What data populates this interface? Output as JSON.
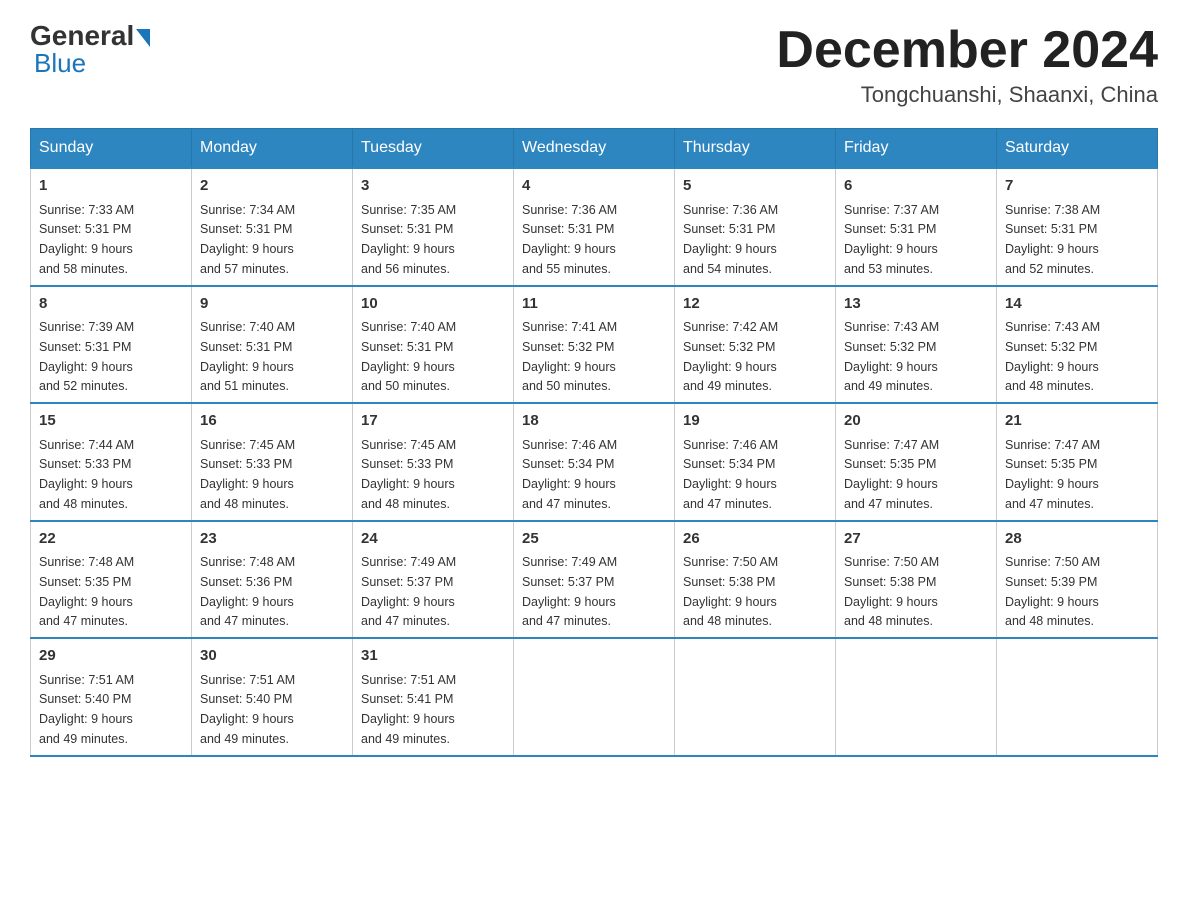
{
  "header": {
    "logo_text_general": "General",
    "logo_text_blue": "Blue",
    "month_title": "December 2024",
    "location": "Tongchuanshi, Shaanxi, China"
  },
  "days_of_week": [
    "Sunday",
    "Monday",
    "Tuesday",
    "Wednesday",
    "Thursday",
    "Friday",
    "Saturday"
  ],
  "weeks": [
    [
      {
        "day": "1",
        "sunrise": "7:33 AM",
        "sunset": "5:31 PM",
        "daylight": "9 hours and 58 minutes."
      },
      {
        "day": "2",
        "sunrise": "7:34 AM",
        "sunset": "5:31 PM",
        "daylight": "9 hours and 57 minutes."
      },
      {
        "day": "3",
        "sunrise": "7:35 AM",
        "sunset": "5:31 PM",
        "daylight": "9 hours and 56 minutes."
      },
      {
        "day": "4",
        "sunrise": "7:36 AM",
        "sunset": "5:31 PM",
        "daylight": "9 hours and 55 minutes."
      },
      {
        "day": "5",
        "sunrise": "7:36 AM",
        "sunset": "5:31 PM",
        "daylight": "9 hours and 54 minutes."
      },
      {
        "day": "6",
        "sunrise": "7:37 AM",
        "sunset": "5:31 PM",
        "daylight": "9 hours and 53 minutes."
      },
      {
        "day": "7",
        "sunrise": "7:38 AM",
        "sunset": "5:31 PM",
        "daylight": "9 hours and 52 minutes."
      }
    ],
    [
      {
        "day": "8",
        "sunrise": "7:39 AM",
        "sunset": "5:31 PM",
        "daylight": "9 hours and 52 minutes."
      },
      {
        "day": "9",
        "sunrise": "7:40 AM",
        "sunset": "5:31 PM",
        "daylight": "9 hours and 51 minutes."
      },
      {
        "day": "10",
        "sunrise": "7:40 AM",
        "sunset": "5:31 PM",
        "daylight": "9 hours and 50 minutes."
      },
      {
        "day": "11",
        "sunrise": "7:41 AM",
        "sunset": "5:32 PM",
        "daylight": "9 hours and 50 minutes."
      },
      {
        "day": "12",
        "sunrise": "7:42 AM",
        "sunset": "5:32 PM",
        "daylight": "9 hours and 49 minutes."
      },
      {
        "day": "13",
        "sunrise": "7:43 AM",
        "sunset": "5:32 PM",
        "daylight": "9 hours and 49 minutes."
      },
      {
        "day": "14",
        "sunrise": "7:43 AM",
        "sunset": "5:32 PM",
        "daylight": "9 hours and 48 minutes."
      }
    ],
    [
      {
        "day": "15",
        "sunrise": "7:44 AM",
        "sunset": "5:33 PM",
        "daylight": "9 hours and 48 minutes."
      },
      {
        "day": "16",
        "sunrise": "7:45 AM",
        "sunset": "5:33 PM",
        "daylight": "9 hours and 48 minutes."
      },
      {
        "day": "17",
        "sunrise": "7:45 AM",
        "sunset": "5:33 PM",
        "daylight": "9 hours and 48 minutes."
      },
      {
        "day": "18",
        "sunrise": "7:46 AM",
        "sunset": "5:34 PM",
        "daylight": "9 hours and 47 minutes."
      },
      {
        "day": "19",
        "sunrise": "7:46 AM",
        "sunset": "5:34 PM",
        "daylight": "9 hours and 47 minutes."
      },
      {
        "day": "20",
        "sunrise": "7:47 AM",
        "sunset": "5:35 PM",
        "daylight": "9 hours and 47 minutes."
      },
      {
        "day": "21",
        "sunrise": "7:47 AM",
        "sunset": "5:35 PM",
        "daylight": "9 hours and 47 minutes."
      }
    ],
    [
      {
        "day": "22",
        "sunrise": "7:48 AM",
        "sunset": "5:35 PM",
        "daylight": "9 hours and 47 minutes."
      },
      {
        "day": "23",
        "sunrise": "7:48 AM",
        "sunset": "5:36 PM",
        "daylight": "9 hours and 47 minutes."
      },
      {
        "day": "24",
        "sunrise": "7:49 AM",
        "sunset": "5:37 PM",
        "daylight": "9 hours and 47 minutes."
      },
      {
        "day": "25",
        "sunrise": "7:49 AM",
        "sunset": "5:37 PM",
        "daylight": "9 hours and 47 minutes."
      },
      {
        "day": "26",
        "sunrise": "7:50 AM",
        "sunset": "5:38 PM",
        "daylight": "9 hours and 48 minutes."
      },
      {
        "day": "27",
        "sunrise": "7:50 AM",
        "sunset": "5:38 PM",
        "daylight": "9 hours and 48 minutes."
      },
      {
        "day": "28",
        "sunrise": "7:50 AM",
        "sunset": "5:39 PM",
        "daylight": "9 hours and 48 minutes."
      }
    ],
    [
      {
        "day": "29",
        "sunrise": "7:51 AM",
        "sunset": "5:40 PM",
        "daylight": "9 hours and 49 minutes."
      },
      {
        "day": "30",
        "sunrise": "7:51 AM",
        "sunset": "5:40 PM",
        "daylight": "9 hours and 49 minutes."
      },
      {
        "day": "31",
        "sunrise": "7:51 AM",
        "sunset": "5:41 PM",
        "daylight": "9 hours and 49 minutes."
      },
      null,
      null,
      null,
      null
    ]
  ],
  "labels": {
    "sunrise_prefix": "Sunrise: ",
    "sunset_prefix": "Sunset: ",
    "daylight_prefix": "Daylight: "
  }
}
